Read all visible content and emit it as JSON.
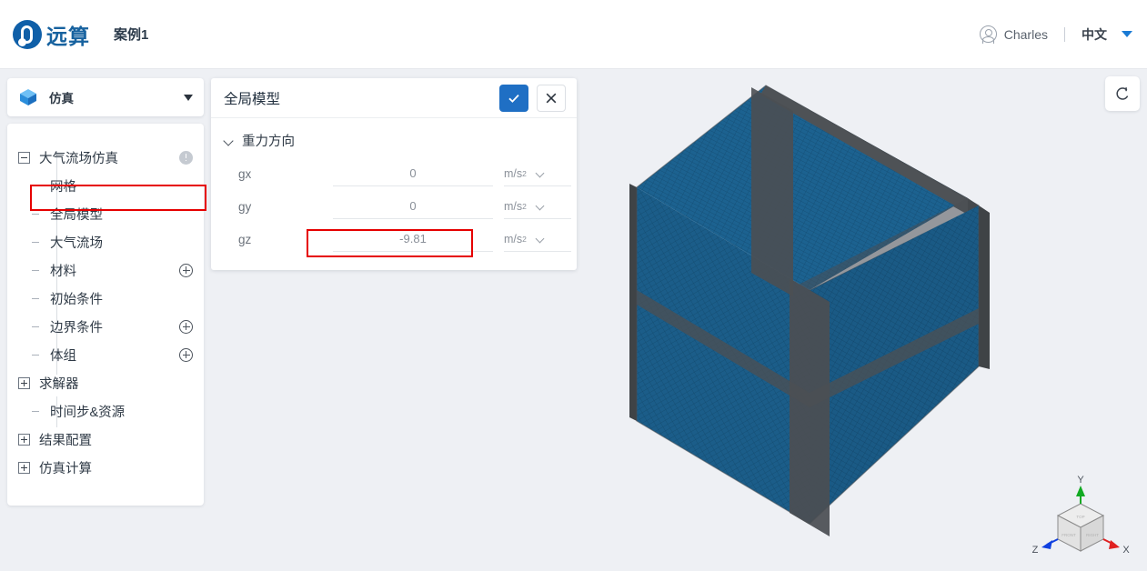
{
  "topbar": {
    "logo_text": "远算",
    "logo_icon": "company-logo-icon",
    "case_title": "案例1",
    "user_name": "Charles",
    "user_icon": "user-avatar-icon",
    "language": "中文",
    "language_caret_icon": "caret-down-icon",
    "accent_color": "#1a7ad4",
    "brand_color": "#17629f"
  },
  "sidebar": {
    "header": {
      "icon": "blue-cube-icon",
      "label": "仿真",
      "caret_icon": "caret-down-icon"
    },
    "tree": [
      {
        "label": "大气流场仿真",
        "level": 0,
        "expander": "minus",
        "badge": "warning-icon"
      },
      {
        "label": "网格",
        "level": 1,
        "expander": "dash",
        "badge": null
      },
      {
        "label": "全局模型",
        "level": 1,
        "expander": "dash",
        "badge": null,
        "selected": true,
        "annotated": true
      },
      {
        "label": "大气流场",
        "level": 1,
        "expander": "dash",
        "badge": null
      },
      {
        "label": "材料",
        "level": 1,
        "expander": "dash",
        "badge": "plus-circle-icon"
      },
      {
        "label": "初始条件",
        "level": 1,
        "expander": "dash",
        "badge": null
      },
      {
        "label": "边界条件",
        "level": 1,
        "expander": "dash",
        "badge": "plus-circle-icon"
      },
      {
        "label": "体组",
        "level": 1,
        "expander": "dash",
        "badge": "plus-circle-icon"
      },
      {
        "label": "求解器",
        "level": 0,
        "expander": "plus",
        "badge": null
      },
      {
        "label": "时间步&资源",
        "level": 1,
        "expander": "dash",
        "badge": null
      },
      {
        "label": "结果配置",
        "level": 0,
        "expander": "plus",
        "badge": null
      },
      {
        "label": "仿真计算",
        "level": 0,
        "expander": "plus",
        "badge": null
      }
    ]
  },
  "panel": {
    "title": "全局模型",
    "confirm_icon": "check-icon",
    "cancel_icon": "close-icon",
    "section": {
      "title": "重力方向",
      "collapse_icon": "chevron-down-icon",
      "fields": [
        {
          "label": "gx",
          "value": "0",
          "placeholder": "0",
          "unit": "m/s",
          "unit_exp": "2",
          "annotated": false
        },
        {
          "label": "gy",
          "value": "0",
          "placeholder": "0",
          "unit": "m/s",
          "unit_exp": "2",
          "annotated": false
        },
        {
          "label": "gz",
          "value": "-9.81",
          "placeholder": "-9.81",
          "unit": "m/s",
          "unit_exp": "2",
          "annotated": true
        }
      ]
    }
  },
  "viewport": {
    "reset_icon": "reset-view-icon",
    "background_color": "#eef0f4",
    "model": {
      "name": "meshed-box-model",
      "mesh_color": "#1b5f8c",
      "edge_color": "#4e5256",
      "top_face_color": "#1a5d88"
    },
    "axis_cube": {
      "name": "orientation-cube",
      "axes": [
        {
          "label": "Y",
          "color": "#11aa22"
        },
        {
          "label": "X",
          "color": "#e02020"
        },
        {
          "label": "Z",
          "color": "#1040e0"
        }
      ],
      "face_labels": [
        "TOP",
        "FRONT",
        "RIGHT"
      ]
    }
  },
  "annotations": {
    "color": "#e60000",
    "boxes": [
      {
        "target": "sidebar-item-全局模型"
      },
      {
        "target": "field-gz-input"
      }
    ]
  }
}
